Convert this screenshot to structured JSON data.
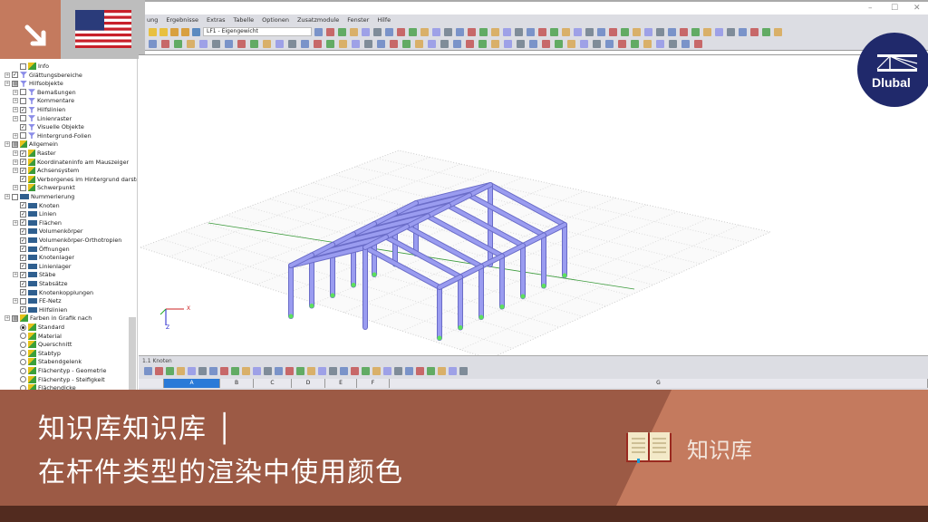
{
  "window": {
    "minimize": "–",
    "maximize": "☐",
    "close": "✕"
  },
  "menu": [
    "ung",
    "Ergebnisse",
    "Extras",
    "Tabelle",
    "Optionen",
    "Zusatzmodule",
    "Fenster",
    "Hilfe"
  ],
  "toolbar": {
    "load_case": "LF1 - Eigengewicht"
  },
  "tree": [
    {
      "label": "Info",
      "lvl": 2,
      "type": "cb",
      "checked": false,
      "icon": "i-col"
    },
    {
      "label": "Glättungsbereiche",
      "lvl": 1,
      "type": "cb",
      "checked": true,
      "icon": "i-aux",
      "exp": true
    },
    {
      "label": "Hilfsobjekte",
      "lvl": 1,
      "type": "cb",
      "checked": "partial",
      "icon": "i-aux",
      "exp": true
    },
    {
      "label": "Bemaßungen",
      "lvl": 2,
      "type": "cb",
      "checked": false,
      "icon": "i-aux",
      "exp": true
    },
    {
      "label": "Kommentare",
      "lvl": 2,
      "type": "cb",
      "checked": false,
      "icon": "i-aux",
      "exp": true
    },
    {
      "label": "Hilfslinien",
      "lvl": 2,
      "type": "cb",
      "checked": true,
      "icon": "i-aux",
      "exp": true
    },
    {
      "label": "Linienraster",
      "lvl": 2,
      "type": "cb",
      "checked": false,
      "icon": "i-aux",
      "exp": true
    },
    {
      "label": "Visuelle Objekte",
      "lvl": 2,
      "type": "cb",
      "checked": true,
      "icon": "i-aux"
    },
    {
      "label": "Hintergrund-Folien",
      "lvl": 2,
      "type": "cb",
      "checked": false,
      "icon": "i-aux",
      "exp": true
    },
    {
      "label": "Allgemein",
      "lvl": 1,
      "type": "cb",
      "checked": "partial",
      "icon": "i-grp",
      "exp": true
    },
    {
      "label": "Raster",
      "lvl": 2,
      "type": "cb",
      "checked": true,
      "icon": "i-grp",
      "exp": true
    },
    {
      "label": "Koordinateninfo am Mauszeiger",
      "lvl": 2,
      "type": "cb",
      "checked": true,
      "icon": "i-grp",
      "exp": true
    },
    {
      "label": "Achsensystem",
      "lvl": 2,
      "type": "cb",
      "checked": true,
      "icon": "i-grp",
      "exp": true
    },
    {
      "label": "Verborgenes im Hintergrund darstε",
      "lvl": 2,
      "type": "cb",
      "checked": true,
      "icon": "i-grp"
    },
    {
      "label": "Schwerpunkt",
      "lvl": 2,
      "type": "cb",
      "checked": false,
      "icon": "i-grp",
      "exp": true
    },
    {
      "label": "Nummerierung",
      "lvl": 1,
      "type": "cb",
      "checked": false,
      "icon": "i-num",
      "exp": true
    },
    {
      "label": "Knoten",
      "lvl": 2,
      "type": "cb",
      "checked": true,
      "icon": "i-num"
    },
    {
      "label": "Linien",
      "lvl": 2,
      "type": "cb",
      "checked": true,
      "icon": "i-num"
    },
    {
      "label": "Flächen",
      "lvl": 2,
      "type": "cb",
      "checked": true,
      "icon": "i-num",
      "exp": true
    },
    {
      "label": "Volumenkörper",
      "lvl": 2,
      "type": "cb",
      "checked": true,
      "icon": "i-num"
    },
    {
      "label": "Volumenkörper-Orthotropien",
      "lvl": 2,
      "type": "cb",
      "checked": true,
      "icon": "i-num"
    },
    {
      "label": "Öffnungen",
      "lvl": 2,
      "type": "cb",
      "checked": true,
      "icon": "i-num"
    },
    {
      "label": "Knotenlager",
      "lvl": 2,
      "type": "cb",
      "checked": true,
      "icon": "i-num"
    },
    {
      "label": "Linienlager",
      "lvl": 2,
      "type": "cb",
      "checked": true,
      "icon": "i-num"
    },
    {
      "label": "Stäbe",
      "lvl": 2,
      "type": "cb",
      "checked": true,
      "icon": "i-num",
      "exp": true
    },
    {
      "label": "Stabsätze",
      "lvl": 2,
      "type": "cb",
      "checked": true,
      "icon": "i-num"
    },
    {
      "label": "Knotenkopplungen",
      "lvl": 2,
      "type": "cb",
      "checked": true,
      "icon": "i-num"
    },
    {
      "label": "FE-Netz",
      "lvl": 2,
      "type": "cb",
      "checked": false,
      "icon": "i-num",
      "exp": true
    },
    {
      "label": "Hilfslinien",
      "lvl": 2,
      "type": "cb",
      "checked": true,
      "icon": "i-num"
    },
    {
      "label": "Farben in Grafik nach",
      "lvl": 1,
      "type": "cb",
      "checked": "partial",
      "icon": "i-col",
      "exp": true
    },
    {
      "label": "Standard",
      "lvl": 2,
      "type": "rd",
      "checked": true,
      "icon": "i-col"
    },
    {
      "label": "Material",
      "lvl": 2,
      "type": "rd",
      "checked": false,
      "icon": "i-col"
    },
    {
      "label": "Querschnitt",
      "lvl": 2,
      "type": "rd",
      "checked": false,
      "icon": "i-col"
    },
    {
      "label": "Stabtyp",
      "lvl": 2,
      "type": "rd",
      "checked": false,
      "icon": "i-col"
    },
    {
      "label": "Stabendgelenk",
      "lvl": 2,
      "type": "rd",
      "checked": false,
      "icon": "i-col"
    },
    {
      "label": "Flächentyp - Geometrie",
      "lvl": 2,
      "type": "rd",
      "checked": false,
      "icon": "i-col"
    },
    {
      "label": "Flächentyp - Steifigkeit",
      "lvl": 2,
      "type": "rd",
      "checked": false,
      "icon": "i-col"
    },
    {
      "label": "Flächendicke",
      "lvl": 2,
      "type": "rd",
      "checked": false,
      "icon": "i-col"
    }
  ],
  "axes": {
    "x": "X",
    "z": "Z"
  },
  "table": {
    "title": "1.1 Knoten",
    "columns": [
      "A",
      "B",
      "C",
      "D",
      "E",
      "F",
      "G"
    ]
  },
  "banner": {
    "line1": "知识库知识库 │",
    "line2": "在杆件类型的渲染中使用颜色",
    "category": "知识库"
  },
  "logo": {
    "text": "Dlubal"
  },
  "colors": {
    "accent": "#c47a5e",
    "dark": "#9c5a45",
    "footer": "#522b1f",
    "member": "#9a9cf0",
    "brand": "#20296b"
  }
}
